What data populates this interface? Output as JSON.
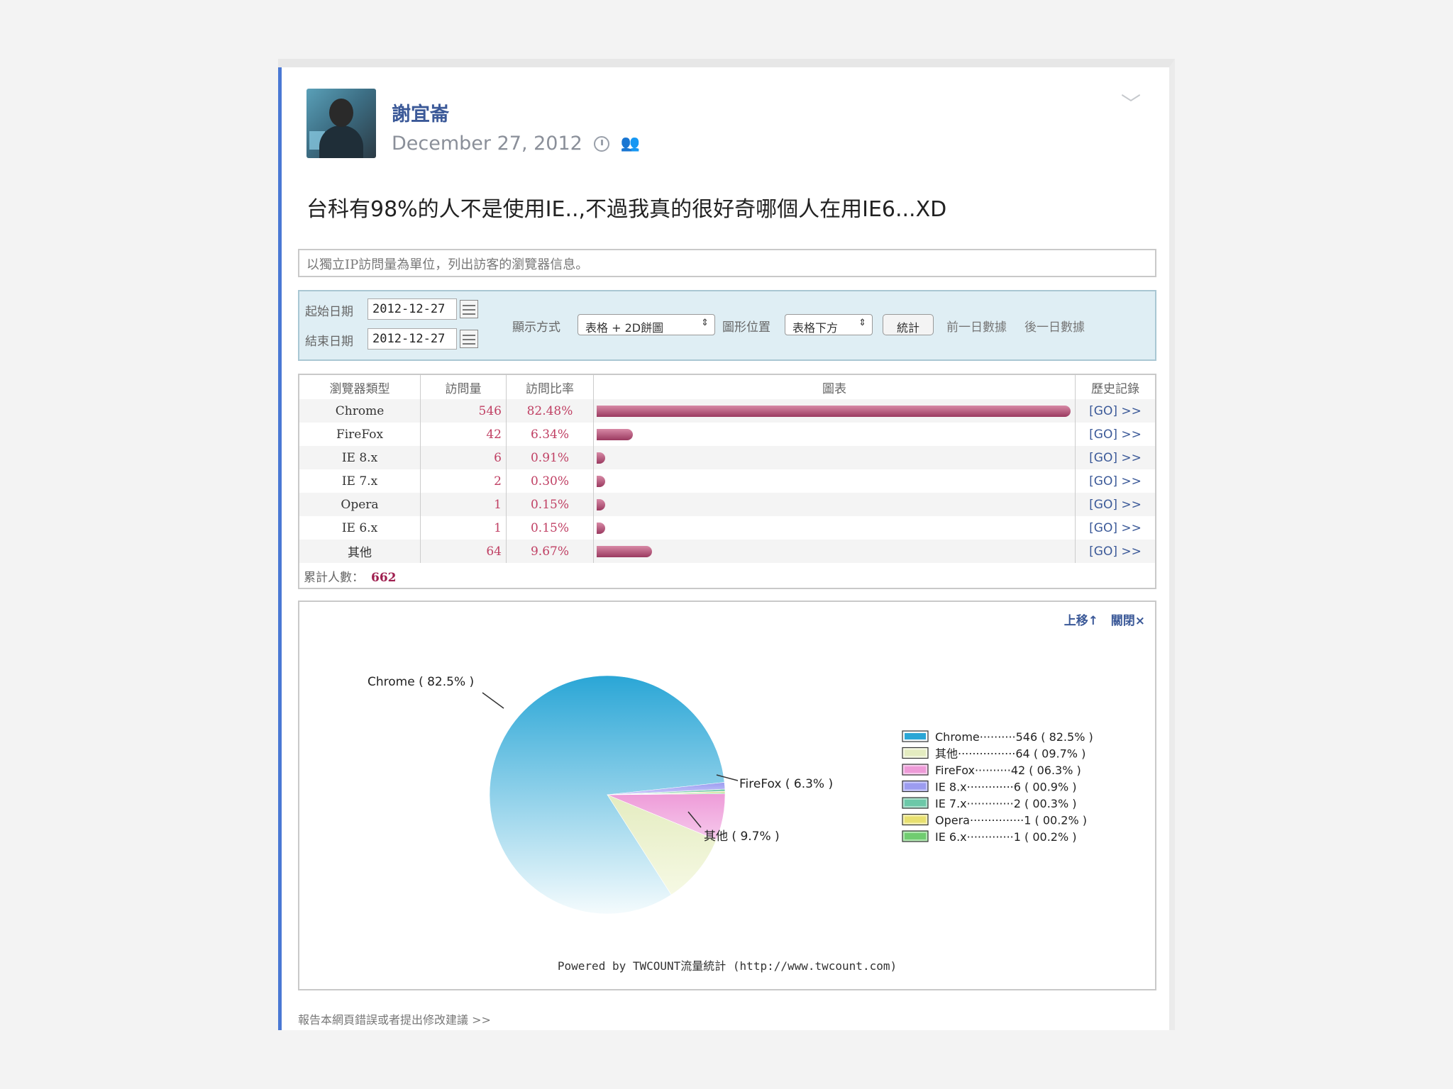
{
  "post": {
    "author": "謝宜崙",
    "date": "December 27, 2012",
    "text": "台科有98%的人不是使用IE..,不過我真的很好奇哪個人在用IE6...XD",
    "menu_icon": "chevron-down-icon"
  },
  "shot": {
    "info": "以獨立IP訪問量為單位，列出訪客的瀏覽器信息。",
    "filter": {
      "start_label": "起始日期",
      "start_value": "2012-12-27",
      "end_label": "結束日期",
      "end_value": "2012-12-27",
      "display_label": "顯示方式",
      "display_value": "表格 + 2D餅圖",
      "position_label": "圖形位置",
      "position_value": "表格下方",
      "stat_button": "統計",
      "prev_day": "前一日數據",
      "next_day": "後一日數據"
    },
    "table": {
      "headers": [
        "瀏覽器類型",
        "訪問量",
        "訪問比率",
        "圖表",
        "歷史記錄"
      ],
      "rows": [
        {
          "name": "Chrome",
          "count": "546",
          "pct": "82.48%",
          "share": 0.8248,
          "go": "[GO] >>"
        },
        {
          "name": "FireFox",
          "count": "42",
          "pct": "6.34%",
          "share": 0.0634,
          "go": "[GO] >>"
        },
        {
          "name": "IE 8.x",
          "count": "6",
          "pct": "0.91%",
          "share": 0.0091,
          "go": "[GO] >>"
        },
        {
          "name": "IE 7.x",
          "count": "2",
          "pct": "0.30%",
          "share": 0.003,
          "go": "[GO] >>"
        },
        {
          "name": "Opera",
          "count": "1",
          "pct": "0.15%",
          "share": 0.0015,
          "go": "[GO] >>"
        },
        {
          "name": "IE 6.x",
          "count": "1",
          "pct": "0.15%",
          "share": 0.0015,
          "go": "[GO] >>"
        },
        {
          "name": "其他",
          "count": "64",
          "pct": "9.67%",
          "share": 0.0967,
          "go": "[GO] >>"
        }
      ],
      "total_label": "累計人數：",
      "total_value": "662"
    },
    "pie_controls": {
      "up": "上移↑",
      "close": "關閉×"
    },
    "powered": "Powered by TWCOUNT流量統計 (http://www.twcount.com)",
    "report_link": "報告本網頁錯誤或者提出修改建議 >>"
  },
  "chart_data": {
    "type": "pie",
    "slices": [
      {
        "label": "Chrome",
        "value": 546,
        "percent": 82.5,
        "color_a": "#2aa6d6",
        "color_b": "#f4fbfd",
        "callout": "Chrome ( 82.5% )",
        "legend": "Chrome··········546 ( 82.5% )"
      },
      {
        "label": "其他",
        "value": 64,
        "percent": 9.7,
        "color_a": "#e4ecc0",
        "color_b": "#f6f9e4",
        "callout": "其他 ( 9.7% )",
        "legend": "其他················64 ( 09.7% )"
      },
      {
        "label": "FireFox",
        "value": 42,
        "percent": 6.3,
        "color_a": "#ee9bd8",
        "color_b": "#f6c9ec",
        "callout": "FireFox ( 6.3% )",
        "legend": "FireFox··········42 ( 06.3% )"
      },
      {
        "label": "IE 8.x",
        "value": 6,
        "percent": 0.9,
        "color_a": "#9c9cf0",
        "color_b": "#c8c8fa",
        "callout": "",
        "legend": "IE 8.x·············6 ( 00.9% )"
      },
      {
        "label": "IE 7.x",
        "value": 2,
        "percent": 0.3,
        "color_a": "#6cc8a8",
        "color_b": "#aae0cc",
        "callout": "",
        "legend": "IE 7.x·············2 ( 00.3% )"
      },
      {
        "label": "Opera",
        "value": 1,
        "percent": 0.2,
        "color_a": "#e8e070",
        "color_b": "#f4f0b0",
        "callout": "",
        "legend": "Opera···············1 ( 00.2% )"
      },
      {
        "label": "IE 6.x",
        "value": 1,
        "percent": 0.2,
        "color_a": "#70cc70",
        "color_b": "#b0e8b0",
        "callout": "",
        "legend": "IE 6.x·············1 ( 00.2% )"
      }
    ]
  }
}
